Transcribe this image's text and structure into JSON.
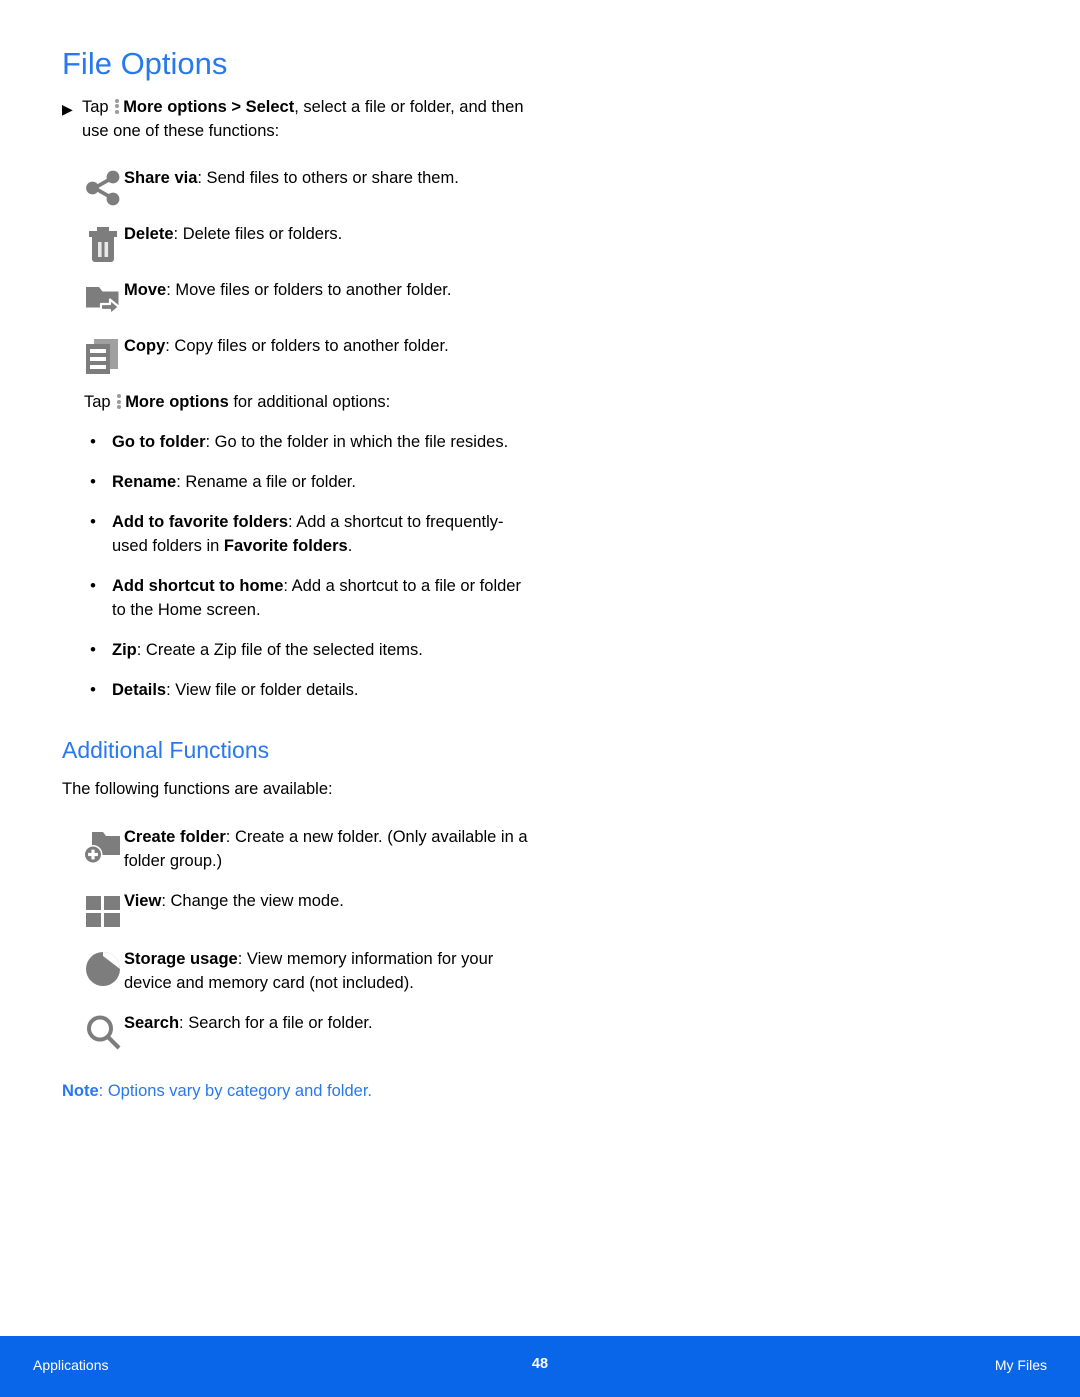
{
  "page": {
    "title": "File Options",
    "section_title": "Additional Functions"
  },
  "intro": {
    "bullet_glyph": "▶",
    "tap_label": "Tap ",
    "more_options_label": "More options",
    "gt": " > ",
    "select_label": "Select",
    "rest": ", select a file or folder, and then use one of these functions:"
  },
  "file_functions": [
    {
      "icon": "share-icon",
      "term": "Share via",
      "desc": ": Send files to others or share them."
    },
    {
      "icon": "delete-trash-icon",
      "term": "Delete",
      "desc": ": Delete files or folders."
    },
    {
      "icon": "move-folder-icon",
      "term": "Move",
      "desc": ": Move files or folders to another folder."
    },
    {
      "icon": "copy-icon",
      "term": "Copy",
      "desc": ": Copy files or folders to another folder."
    }
  ],
  "more_options_intro": {
    "tap_label": "Tap ",
    "more_options_label": "More options",
    "rest": " for additional options:"
  },
  "more_options_list": [
    {
      "term": "Go to folder",
      "desc": ": Go to the folder in which the file resides.",
      "desc_tail": ""
    },
    {
      "term": "Rename",
      "desc": ": Rename a file or folder.",
      "desc_tail": ""
    },
    {
      "term": "Add to favorite folders",
      "desc": ": Add a shortcut to frequently-used folders in ",
      "emphasis": "Favorite folders",
      "desc_tail": "."
    },
    {
      "term": "Add shortcut to home",
      "desc": ": Add a shortcut to a file or folder to the Home screen.",
      "desc_tail": ""
    },
    {
      "term": "Zip",
      "desc": ": Create a Zip file of the selected items.",
      "desc_tail": ""
    },
    {
      "term": "Details",
      "desc": ": View file or folder details.",
      "desc_tail": ""
    }
  ],
  "additional": {
    "lead": "The following functions are available:",
    "functions": [
      {
        "icon": "create-folder-icon",
        "term": "Create folder",
        "desc": ": Create a new folder. (Only available in a folder group.)"
      },
      {
        "icon": "view-grid-icon",
        "term": "View",
        "desc": ": Change the view mode."
      },
      {
        "icon": "storage-usage-pie-icon",
        "term": "Storage usage",
        "desc": ": View memory information for your device and memory card (not included)."
      },
      {
        "icon": "search-icon",
        "term": "Search",
        "desc": ": Search for a file or folder."
      }
    ]
  },
  "note": {
    "label": "Note",
    "text": ": Options vary by category and folder."
  },
  "footer": {
    "left": "Applications",
    "page_number": "48",
    "right": "My Files"
  },
  "colors": {
    "heading_blue": "#2878f0",
    "footer_blue": "#0a66e8",
    "icon_gray": "#7d7d7d"
  }
}
